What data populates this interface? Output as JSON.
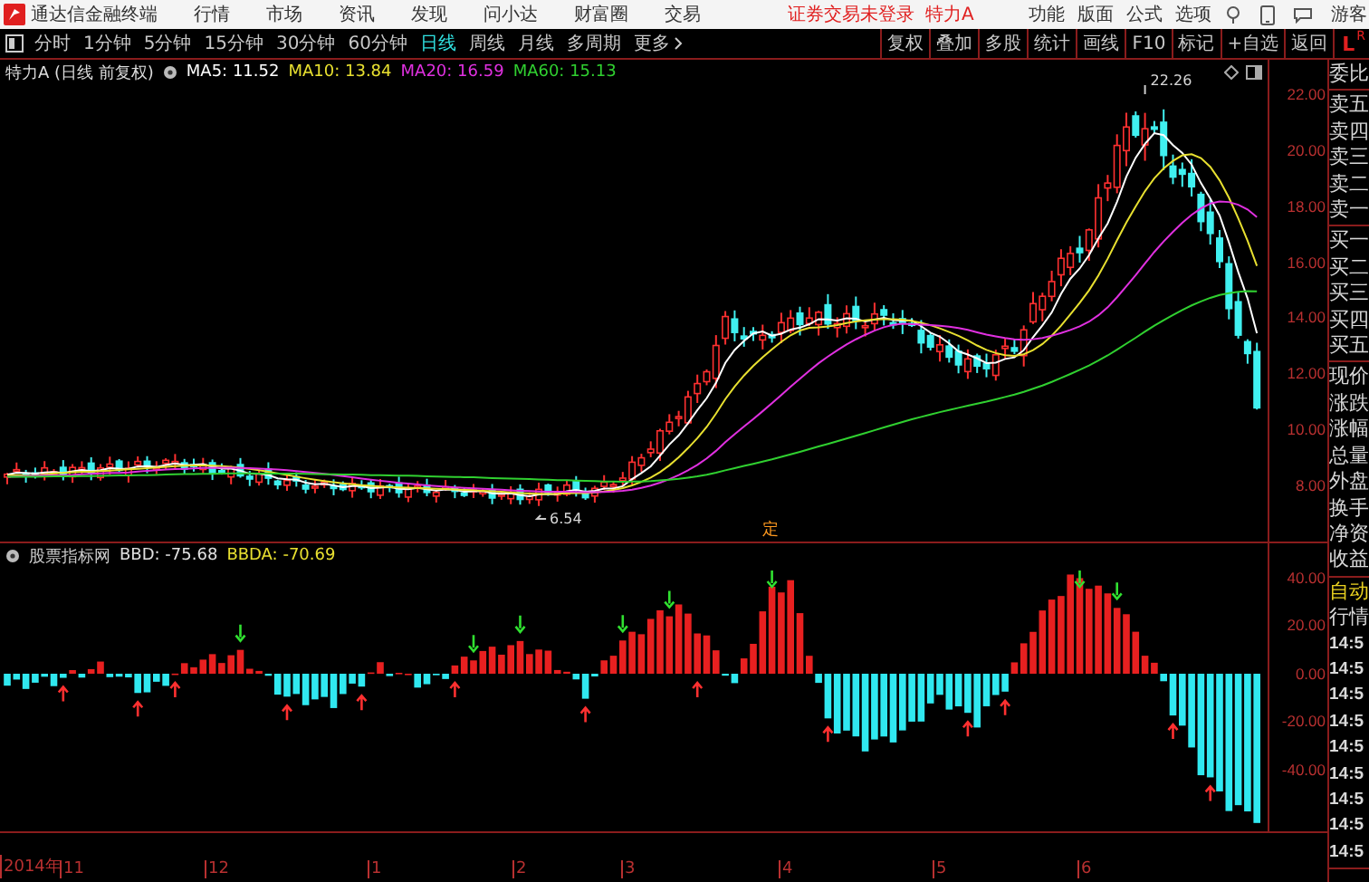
{
  "app": {
    "title": "通达信金融终端",
    "menu": [
      "行情",
      "市场",
      "资讯",
      "发现",
      "问小达",
      "财富圈",
      "交易"
    ],
    "notice": "证券交易未登录",
    "stock": "特力A",
    "tools": [
      "功能",
      "版面",
      "公式",
      "选项"
    ],
    "user": "游客"
  },
  "periods": [
    {
      "label": "分时",
      "selected": false
    },
    {
      "label": "1分钟",
      "selected": false
    },
    {
      "label": "5分钟",
      "selected": false
    },
    {
      "label": "15分钟",
      "selected": false
    },
    {
      "label": "30分钟",
      "selected": false
    },
    {
      "label": "60分钟",
      "selected": false
    },
    {
      "label": "日线",
      "selected": true
    },
    {
      "label": "周线",
      "selected": false
    },
    {
      "label": "月线",
      "selected": false
    },
    {
      "label": "多周期",
      "selected": false
    },
    {
      "label": "更多",
      "selected": false
    }
  ],
  "actions": [
    "复权",
    "叠加",
    "多股",
    "统计",
    "画线",
    "F10",
    "标记",
    "+自选",
    "返回"
  ],
  "corner_mark": {
    "big": "L",
    "small": "R"
  },
  "price_chart": {
    "title": "特力A (日线 前复权)",
    "ma": [
      {
        "label": "MA5: 11.52",
        "color": "#ffffff"
      },
      {
        "label": "MA10: 13.84",
        "color": "#e8e030"
      },
      {
        "label": "MA20: 16.59",
        "color": "#e030e0"
      },
      {
        "label": "MA60: 15.13",
        "color": "#30d030"
      }
    ],
    "high_label": "22.26",
    "low_label": "6.54",
    "marker": "定",
    "yticks": [
      "22.00",
      "20.00",
      "18.00",
      "16.00",
      "14.00",
      "12.00",
      "10.00",
      "8.00"
    ]
  },
  "indicator": {
    "title": "股票指标网",
    "lines": [
      {
        "label": "BBD: -75.68",
        "color": "#e0e0e0"
      },
      {
        "label": "BBDA: -70.69",
        "color": "#e8e030"
      }
    ],
    "yticks": [
      "40.00",
      "20.00",
      "0.00",
      "-20.00",
      "-40.00"
    ]
  },
  "x_axis": [
    "2014年",
    "11",
    "12",
    "1",
    "2",
    "3",
    "4",
    "5",
    "6"
  ],
  "side_panel": [
    [
      {
        "text": "委比",
        "kind": "field"
      }
    ],
    [
      {
        "text": "卖五",
        "kind": "field"
      },
      {
        "text": "卖四",
        "kind": "field"
      },
      {
        "text": "卖三",
        "kind": "field"
      },
      {
        "text": "卖二",
        "kind": "field"
      },
      {
        "text": "卖一",
        "kind": "field"
      }
    ],
    [
      {
        "text": "买一",
        "kind": "field"
      },
      {
        "text": "买二",
        "kind": "field"
      },
      {
        "text": "买三",
        "kind": "field"
      },
      {
        "text": "买四",
        "kind": "field"
      },
      {
        "text": "买五",
        "kind": "field"
      }
    ],
    [
      {
        "text": "现价",
        "kind": "field"
      },
      {
        "text": "涨跌",
        "kind": "field"
      },
      {
        "text": "涨幅",
        "kind": "field"
      },
      {
        "text": "总量",
        "kind": "field"
      },
      {
        "text": "外盘",
        "kind": "field"
      },
      {
        "text": "换手",
        "kind": "field"
      },
      {
        "text": "净资",
        "kind": "field"
      },
      {
        "text": "收益",
        "kind": "field"
      }
    ],
    [
      {
        "text": "自动",
        "kind": "status"
      },
      {
        "text": "行情",
        "kind": "field"
      },
      {
        "text": "14:5",
        "kind": "time"
      },
      {
        "text": "14:5",
        "kind": "time"
      },
      {
        "text": "14:5",
        "kind": "time"
      },
      {
        "text": "14:5",
        "kind": "time"
      },
      {
        "text": "14:5",
        "kind": "time"
      },
      {
        "text": "14:5",
        "kind": "time"
      },
      {
        "text": "14:5",
        "kind": "time"
      },
      {
        "text": "14:5",
        "kind": "time"
      },
      {
        "text": "14:5",
        "kind": "time"
      }
    ]
  ]
}
